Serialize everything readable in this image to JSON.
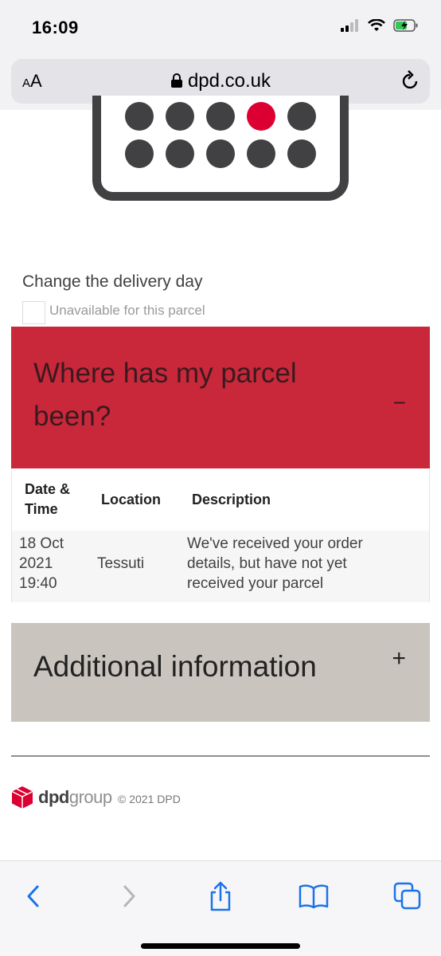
{
  "status_bar": {
    "time": "16:09"
  },
  "browser": {
    "text_size_label_small": "A",
    "text_size_label_large": "A",
    "domain": "dpd.co.uk",
    "icons": [
      "lock-icon",
      "reload-icon",
      "back-icon",
      "forward-icon",
      "share-icon",
      "bookmarks-icon",
      "tabs-icon"
    ]
  },
  "delivery_day": {
    "label": "Change the delivery day",
    "status": "Unavailable for this parcel"
  },
  "parcel_history": {
    "title": "Where has my parcel been?",
    "toggle": "−",
    "columns": {
      "date_line1": "Date &",
      "date_line2": "Time",
      "location": "Location",
      "description": "Description"
    },
    "rows": [
      {
        "date": "18 Oct",
        "year": "2021",
        "time": "19:40",
        "location": "Tessuti",
        "desc_line1": "We've received your order",
        "desc_line2": "details, but have not yet",
        "desc_line3": "received your parcel"
      }
    ]
  },
  "additional_info": {
    "title": "Additional information",
    "toggle": "+"
  },
  "footer": {
    "logo_bold": "dpd",
    "logo_light": "group",
    "copyright": "© 2021 DPD"
  },
  "colors": {
    "brand_red": "#dc0032",
    "panel_red": "#c8283a",
    "panel_grey": "#cac4be",
    "ios_blue": "#1a73e8"
  }
}
